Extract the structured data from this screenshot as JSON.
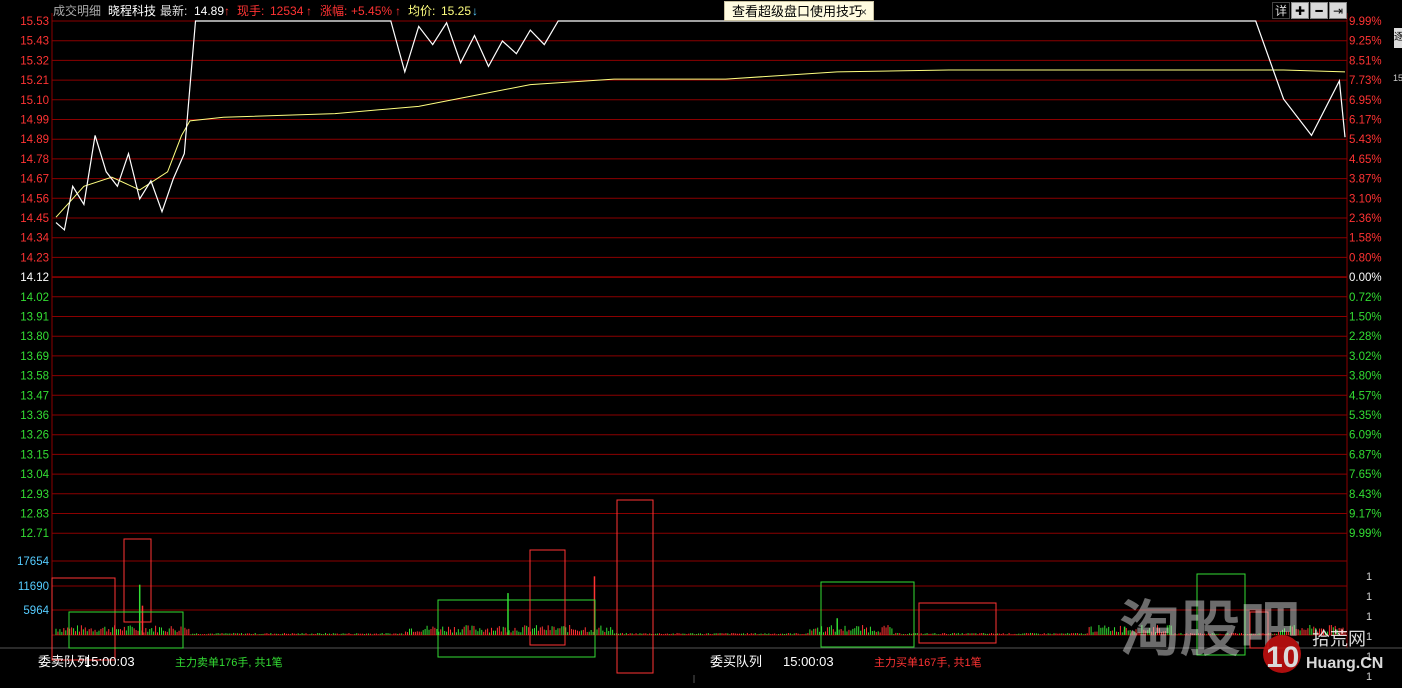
{
  "header": {
    "tab_label": "成交明细",
    "stock_name": "晓程科技",
    "latest_label": "最新:",
    "latest_value": "14.89",
    "latest_arrow": "↑",
    "hand_label": "现手:",
    "hand_value": "12534",
    "hand_arrow": "↑",
    "change_label": "涨幅:",
    "change_value": "+5.45%",
    "change_arrow": "↑",
    "avg_label": "均价:",
    "avg_value": "15.25",
    "avg_arrow": "↓"
  },
  "tip": {
    "text": "查看超级盘口使用技巧",
    "close": "×"
  },
  "toolbar": {
    "detail": "详",
    "plus": "✚",
    "minus": "━",
    "exit": "⇥"
  },
  "side_button": {
    "text": "逐"
  },
  "side_value": {
    "text": "15"
  },
  "axis": {
    "left_prices": [
      "15.53",
      "15.43",
      "15.32",
      "15.21",
      "15.10",
      "14.99",
      "14.89",
      "14.78",
      "14.67",
      "14.56",
      "14.45",
      "14.34",
      "14.23",
      "14.12",
      "14.02",
      "13.91",
      "13.80",
      "13.69",
      "13.58",
      "13.47",
      "13.36",
      "13.26",
      "13.15",
      "13.04",
      "12.93",
      "12.83",
      "12.71"
    ],
    "right_pcts": [
      "9.99%",
      "9.25%",
      "8.51%",
      "7.73%",
      "6.95%",
      "6.17%",
      "5.43%",
      "4.65%",
      "3.87%",
      "3.10%",
      "2.36%",
      "1.58%",
      "0.80%",
      "0.00%",
      "0.72%",
      "1.50%",
      "2.28%",
      "3.02%",
      "3.80%",
      "4.57%",
      "5.35%",
      "6.09%",
      "6.87%",
      "7.65%",
      "8.43%",
      "9.17%",
      "9.99%"
    ],
    "volume_labels": [
      "17654",
      "11690",
      "5964"
    ],
    "right_volume_labels": [
      "1",
      "1",
      "1",
      "1",
      "1",
      "1",
      "1"
    ]
  },
  "bottom": {
    "left_queue_label": "委卖队列",
    "left_time": "15:00:03",
    "left_info": "主力卖单176手, 共1笔",
    "right_queue_label": "委买队列",
    "right_time": "15:00:03",
    "right_info": "主力买单167手, 共1笔"
  },
  "watermark": {
    "main": "淘股吧",
    "site_top": "拾荒网",
    "site_bottom": "Huang.CN",
    "site_num": "10"
  },
  "colors": {
    "background": "#000000",
    "grid": "#8b0000",
    "price_line": "#ffffff",
    "avg_line": "#ffff80",
    "up": "#ff3333",
    "down": "#33dd33",
    "flat": "#ffffff",
    "volume_axis": "#55ccff",
    "box_red": "#ff3333",
    "box_green": "#33dd33"
  },
  "chart_data": {
    "type": "line",
    "y_price_range": [
      12.71,
      15.53
    ],
    "prev_close": 14.12,
    "series": [
      {
        "kind": "price",
        "x": [
          0,
          3,
          6,
          10,
          14,
          18,
          22,
          26,
          30,
          34,
          38,
          42,
          46,
          50,
          54,
          58,
          62,
          66,
          70,
          72,
          74,
          76,
          80,
          90,
          100,
          110,
          120,
          125,
          130,
          135,
          140,
          145,
          150,
          155,
          160,
          165,
          170,
          175,
          180,
          185,
          190,
          195,
          198,
          200,
          205,
          210,
          215,
          220,
          225,
          230,
          235,
          240,
          300,
          360,
          361,
          362,
          380,
          400,
          420,
          430,
          440,
          450,
          460,
          462
        ],
        "y": [
          14.42,
          14.38,
          14.62,
          14.52,
          14.9,
          14.7,
          14.62,
          14.8,
          14.55,
          14.65,
          14.48,
          14.66,
          14.8,
          15.53,
          15.53,
          15.53,
          15.53,
          15.53,
          15.53,
          15.53,
          15.53,
          15.53,
          15.53,
          15.53,
          15.53,
          15.53,
          15.53,
          15.25,
          15.5,
          15.4,
          15.52,
          15.3,
          15.45,
          15.28,
          15.42,
          15.35,
          15.48,
          15.4,
          15.53,
          15.53,
          15.53,
          15.53,
          15.53,
          15.53,
          15.53,
          15.53,
          15.53,
          15.53,
          15.53,
          15.53,
          15.53,
          15.53,
          15.53,
          15.53,
          15.53,
          15.53,
          15.53,
          15.53,
          15.53,
          15.53,
          15.1,
          14.9,
          15.2,
          14.89
        ]
      },
      {
        "kind": "avg",
        "x": [
          0,
          10,
          20,
          30,
          40,
          45,
          48,
          60,
          100,
          130,
          150,
          170,
          200,
          240,
          280,
          320,
          360,
          400,
          440,
          462
        ],
        "y": [
          14.45,
          14.62,
          14.67,
          14.6,
          14.7,
          14.9,
          14.98,
          15.0,
          15.02,
          15.06,
          15.12,
          15.18,
          15.21,
          15.21,
          15.25,
          15.26,
          15.26,
          15.26,
          15.26,
          15.25
        ]
      }
    ],
    "volume_peaks": [
      {
        "x": 30,
        "v": 12000,
        "dir": "down"
      },
      {
        "x": 31,
        "v": 7000,
        "dir": "up"
      },
      {
        "x": 162,
        "v": 10000,
        "dir": "down"
      },
      {
        "x": 193,
        "v": 14000,
        "dir": "up"
      },
      {
        "x": 280,
        "v": 4000,
        "dir": "down"
      },
      {
        "x": 383,
        "v": 2000,
        "dir": "down"
      }
    ]
  }
}
